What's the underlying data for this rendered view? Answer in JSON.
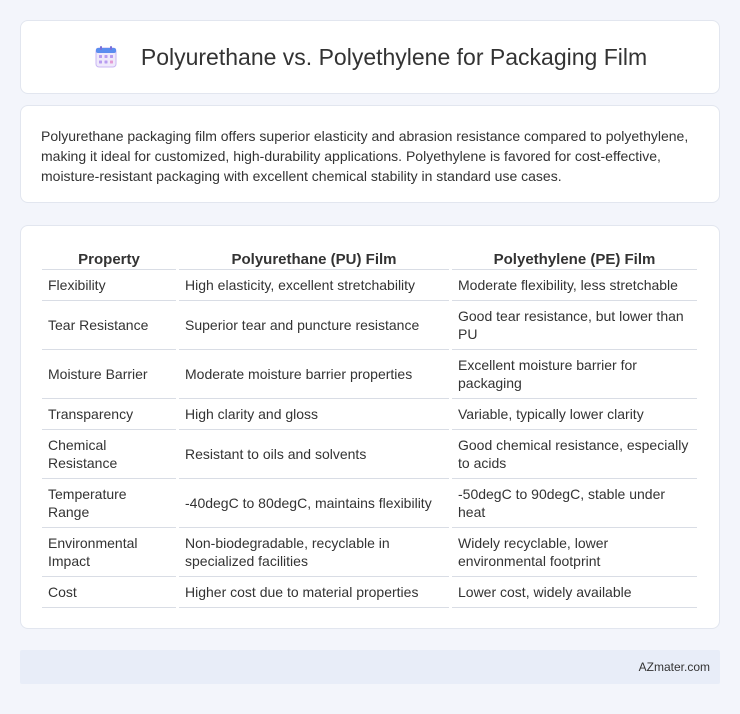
{
  "header": {
    "title": "Polyurethane vs. Polyethylene for Packaging Film",
    "icon": "calendar-icon",
    "icon_colors": {
      "top": "#5b8def",
      "grid": "#b79cf0"
    }
  },
  "summary": "Polyurethane packaging film offers superior elasticity and abrasion resistance compared to polyethylene, making it ideal for customized, high-durability applications. Polyethylene is favored for cost-effective, moisture-resistant packaging with excellent chemical stability in standard use cases.",
  "table": {
    "headers": [
      "Property",
      "Polyurethane (PU) Film",
      "Polyethylene (PE) Film"
    ],
    "rows": [
      [
        "Flexibility",
        "High elasticity, excellent stretchability",
        "Moderate flexibility, less stretchable"
      ],
      [
        "Tear Resistance",
        "Superior tear and puncture resistance",
        "Good tear resistance, but lower than PU"
      ],
      [
        "Moisture Barrier",
        "Moderate moisture barrier properties",
        "Excellent moisture barrier for packaging"
      ],
      [
        "Transparency",
        "High clarity and gloss",
        "Variable, typically lower clarity"
      ],
      [
        "Chemical Resistance",
        "Resistant to oils and solvents",
        "Good chemical resistance, especially to acids"
      ],
      [
        "Temperature Range",
        "-40degC to 80degC, maintains flexibility",
        "-50degC to 90degC, stable under heat"
      ],
      [
        "Environmental Impact",
        "Non-biodegradable, recyclable in specialized facilities",
        "Widely recyclable, lower environmental footprint"
      ],
      [
        "Cost",
        "Higher cost due to material properties",
        "Lower cost, widely available"
      ]
    ]
  },
  "footer": {
    "brand": "AZmater.com"
  }
}
